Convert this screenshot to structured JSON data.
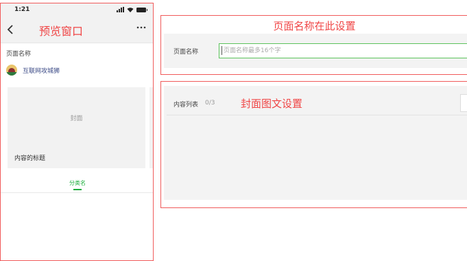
{
  "preview": {
    "status_time": "1:21",
    "title": "预览窗口",
    "page_name_label": "页面名称",
    "account_name": "互联网攻城狮",
    "cover_text": "封面",
    "content_title": "内容的标题",
    "category_tab": "分类名"
  },
  "name_section": {
    "annotation": "页面名称在此设置",
    "label": "页面名称",
    "placeholder": "页面名称最多16个字"
  },
  "cover_section": {
    "content_list_label": "内容列表",
    "content_count": "0/3",
    "annotation": "封面图文设置"
  },
  "colors": {
    "annotation_red": "#f04545",
    "accent_green": "#1aad3b",
    "panel_gray": "#f3f3f3"
  }
}
